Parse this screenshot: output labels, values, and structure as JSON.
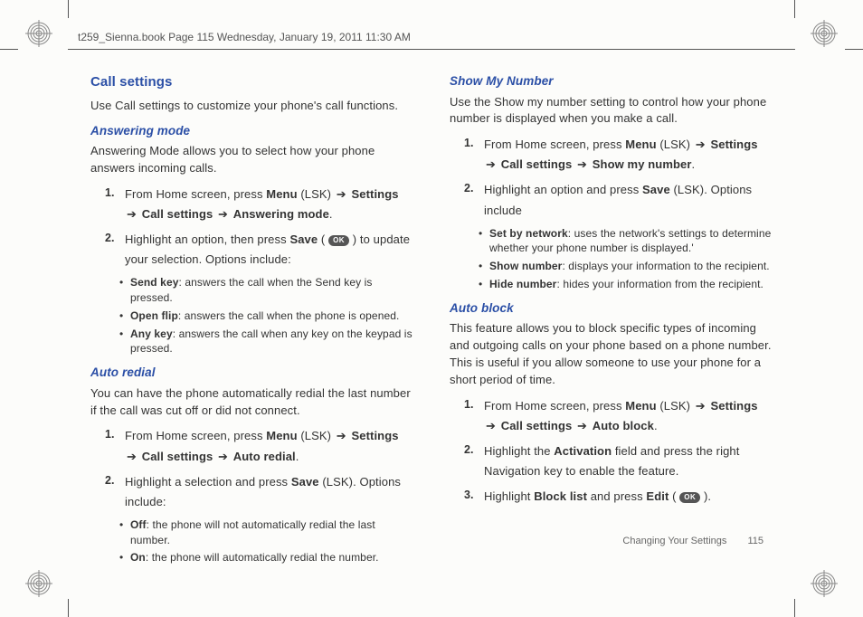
{
  "bookmeta": "t259_Sienna.book  Page 115  Wednesday, January 19, 2011  11:30 AM",
  "ok_label": "OK",
  "arrow": "➔",
  "left": {
    "h1": "Call settings",
    "intro": "Use Call settings to customize your phone's call functions.",
    "ans": {
      "title": "Answering mode",
      "para": "Answering Mode allows you to select how your phone answers incoming calls.",
      "step1_a": "From Home screen, press ",
      "step1_b": "Menu",
      "step1_c": " (LSK) ",
      "step1_d": "Settings",
      "step1_e": "Call settings",
      "step1_f": "Answering mode",
      "step2_a": "Highlight an option, then press ",
      "step2_b": "Save",
      "step2_c": " ( ",
      "step2_d": " ) to update your selection. Options include:",
      "b1_a": "Send key",
      "b1_b": ": answers the call when the Send key is pressed.",
      "b2_a": "Open flip",
      "b2_b": ": answers the call when the phone is opened.",
      "b3_a": "Any key",
      "b3_b": ": answers the call when any key on the keypad is pressed."
    },
    "redial": {
      "title": "Auto redial",
      "para": "You can have the phone automatically redial the last number if the call was cut off or did not connect.",
      "step1_a": "From Home screen, press ",
      "step1_b": "Menu",
      "step1_c": " (LSK) ",
      "step1_d": "Settings",
      "step1_e": "Call settings",
      "step1_f": "Auto redial",
      "step2_a": "Highlight a selection and press ",
      "step2_b": "Save",
      "step2_c": " (LSK). Options include:",
      "b1_a": "Off",
      "b1_b": ": the phone will not automatically redial the last number.",
      "b2_a": "On",
      "b2_b": ": the phone will automatically redial the number."
    }
  },
  "right": {
    "show": {
      "title": "Show My Number",
      "para": "Use the Show my number setting to control how your phone number is displayed when you make a call.",
      "step1_a": "From Home screen, press ",
      "step1_b": "Menu",
      "step1_c": " (LSK) ",
      "step1_d": "Settings",
      "step1_e": "Call settings",
      "step1_f": "Show my number",
      "step2_a": "Highlight an option and press ",
      "step2_b": "Save",
      "step2_c": " (LSK). Options include",
      "b1_a": "Set by network",
      "b1_b": ": uses the network's settings to determine whether your phone number is displayed.'",
      "b2_a": "Show number",
      "b2_b": ": displays your information to the recipient.",
      "b3_a": "Hide number",
      "b3_b": ": hides your information from the recipient."
    },
    "block": {
      "title": "Auto block",
      "para": "This feature allows you to block specific types of incoming and outgoing calls on your phone based on a phone number. This is useful if you allow someone to use your phone for a short period of time.",
      "step1_a": "From Home screen, press ",
      "step1_b": "Menu",
      "step1_c": " (LSK) ",
      "step1_d": "Settings",
      "step1_e": "Call settings",
      "step1_f": "Auto block",
      "step2_a": "Highlight the ",
      "step2_b": "Activation",
      "step2_c": " field and press the right Navigation key to enable the feature.",
      "step3_a": "Highlight ",
      "step3_b": "Block list",
      "step3_c": " and press ",
      "step3_d": "Edit",
      "step3_e": " ( ",
      "step3_f": " )."
    }
  },
  "footer": {
    "section": "Changing Your Settings",
    "page": "115"
  }
}
